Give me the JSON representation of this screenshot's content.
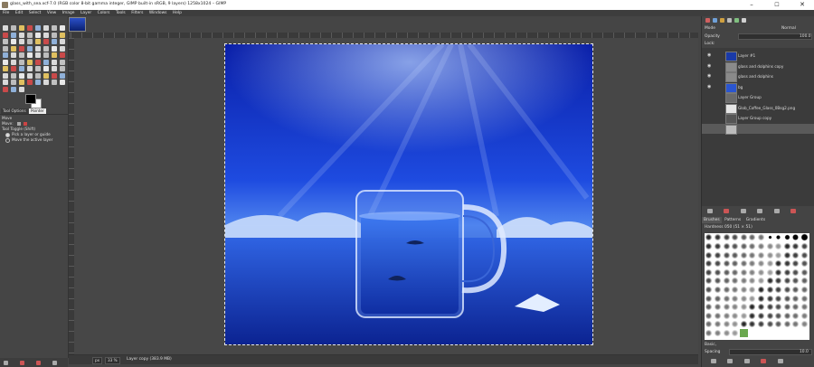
{
  "window": {
    "title": "glass_with_sea.xcf-7.0 (RGB color 8-bit gamma integer, GIMP built-in sRGB, 9 layers) 1258x1024 – GIMP",
    "minimize": "–",
    "maximize": "☐",
    "close": "✕"
  },
  "menu": [
    "File",
    "Edit",
    "Select",
    "View",
    "Image",
    "Layer",
    "Colors",
    "Tools",
    "Filters",
    "Windows",
    "Help"
  ],
  "toolbox": {
    "tooltip": "Pointer",
    "tabs": [
      "Tool Options"
    ],
    "options_title": "Move",
    "move_label": "Move:",
    "tool_toggle": "Tool Toggle  (Shift)",
    "option1": "Pick a layer or guide",
    "option2": "Move the active layer"
  },
  "status": {
    "unit": "px",
    "zoom": "33 %",
    "message": "Layer copy (383.9 MB)"
  },
  "dock": {
    "mode_label": "Mode",
    "mode_value": "Normal",
    "opacity_label": "Opacity",
    "opacity_value": "100.0",
    "lock_label": "Lock:",
    "layers": [
      {
        "name": "Layer #1",
        "thumb": "#1a3aa8",
        "selected": false,
        "eye": true
      },
      {
        "name": "glass and dolphins copy",
        "thumb": "#8a8a8a",
        "selected": false,
        "eye": true
      },
      {
        "name": "glass and dolphins",
        "thumb": "#8a8a8a",
        "selected": false,
        "eye": true
      },
      {
        "name": "bg",
        "thumb": "#2a55d0",
        "selected": false,
        "eye": true
      },
      {
        "name": "Layer Group",
        "thumb": "#6a6a6a",
        "selected": false,
        "eye": false
      },
      {
        "name": "Glob_Coffee_Glass_0Bsg2.png",
        "thumb": "#e6e6e6",
        "selected": false,
        "eye": false
      },
      {
        "name": "Layer Group copy",
        "thumb": "#555555",
        "selected": false,
        "eye": false
      },
      {
        "name": "",
        "thumb": "#bbbbbb",
        "selected": true,
        "eye": false
      }
    ],
    "tabs": [
      "Brushes",
      "Patterns",
      "Gradients"
    ],
    "brush_label": "Hardness 050 (51 × 51)",
    "preset_label": "Basic,",
    "spacing_label": "Spacing",
    "spacing_value": "10.0"
  }
}
